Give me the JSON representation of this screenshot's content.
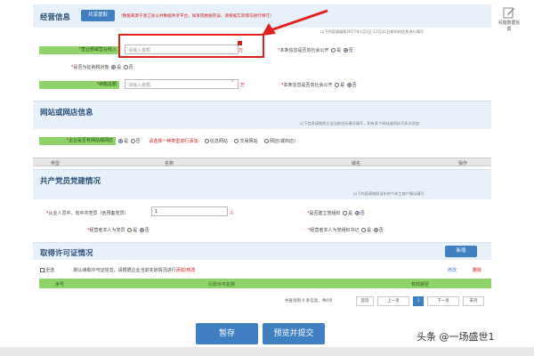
{
  "header": {
    "title": "经营信息",
    "share_button": "共享提取",
    "notice": "（数据来源于浙江省公共数据共享平台，如发现数据有误，请根据实际情况进行填写）",
    "period_note": "以下内容请填报2017年1月1日-12月31日期间的信息进行填写"
  },
  "feedback": {
    "label": "问题数据反馈"
  },
  "business": {
    "revenue_label": "营业额或营业收入",
    "revenue_placeholder": "请输入金额",
    "revenue_unit": "万",
    "taxpayer_label": "是否为征纳税对象",
    "taxpayer_yes": "是",
    "taxpayer_no": "否",
    "tax_label": "纳税总额",
    "tax_placeholder": "请输入金额",
    "tax_unit": "万",
    "public1_label": "本条信息是否向社会公开",
    "public1_yes": "是",
    "public1_no": "否",
    "public2_label": "本条信息是否向社会公开",
    "public2_yes": "是",
    "public2_no": "否"
  },
  "website": {
    "title": "网站或网店信息",
    "note": "以下信息请按照企业当前实际情况填写，如有多个网站或网店可多次添加",
    "has_site_label": "企业是否有网站或网店",
    "yes": "是",
    "no": "否",
    "choose_prompt": "请选择一种类型进行添加：",
    "opt1": "信息网站",
    "opt2": "交易网站",
    "opt3": "网店(或商店)",
    "columns": [
      "类型",
      "名称",
      "域名",
      "操作"
    ]
  },
  "party": {
    "title": "共产党员党建情况",
    "note": "以下内容请按照当年的个体工商户情况填写",
    "members_label": "从业人员中，有中共党员（含预备党员）",
    "members_value": "1",
    "members_unit": "人",
    "org_label": "是否建立党组织",
    "yes": "是",
    "no": "否",
    "operator_party_label": "经营者本人为党员",
    "secretary_label": "经营者本人为党组织书记"
  },
  "license": {
    "title": "取得许可证情况",
    "add_button": "新增",
    "select_all": "全选",
    "note": "默认读取许可证信息，请根据企业当前实际情况进行",
    "note_link": "添加/修改",
    "edit": "修改",
    "delete": "删除",
    "columns": [
      "序号",
      "行政许可名称",
      "有效期至"
    ]
  },
  "pagination": {
    "summary": "共查询到 0 条信息，共0页",
    "first": "首页",
    "prev": "上一页",
    "current": "1",
    "next": "下一页",
    "last": "末页"
  },
  "footer": {
    "save": "暂存",
    "submit": "预览并提交"
  },
  "watermark": "头条 @一场盛世1",
  "colors": {
    "accent": "#3f7fc2",
    "highlight": "#e32020",
    "label_green": "#8fd36a"
  }
}
